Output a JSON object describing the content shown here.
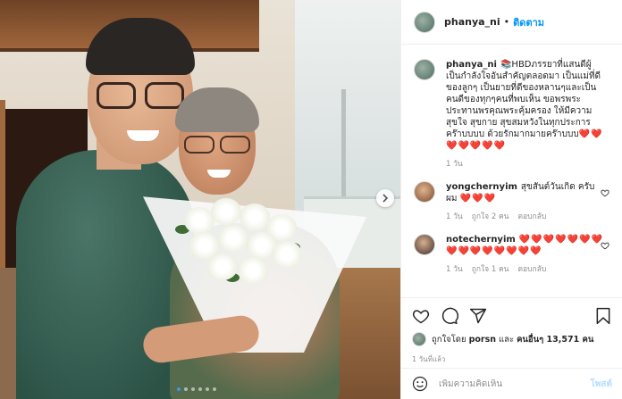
{
  "post": {
    "username": "phanya_ni",
    "follow_label": "ติดตาม",
    "separator": "•",
    "image_alt_icon": "photo",
    "carousel": {
      "total_slides": 6,
      "active_index": 0
    }
  },
  "caption": {
    "username": "phanya_ni",
    "text": "📚HBDภรรยาที่แสนดีผู้เป็นกำลังใจอันสำคัญตลอดมา เป็นแม่ที่ดีของลูกๆ เป็นยายที่ดีของหลานๆและเป็นคนดีของทุกๆคนที่พบเห็น ขอพรพระประทานพรคุณพระคุ้มครอง ให้มีความสุขใจ สุขกาย สุขสมหวังในทุกประการคร๊าบบบบ ด้วยรักมากมายคร๊าบบบ",
    "hearts": "❤️❤️❤️❤️❤️❤️❤️",
    "time": "1 วัน"
  },
  "comments": [
    {
      "username": "yongchernyim",
      "text": "สุขสันต์วันเกิด ครับผม",
      "hearts": "❤️❤️❤️",
      "time": "1 วัน",
      "likes": "ถูกใจ 2 คน",
      "reply": "ตอบกลับ"
    },
    {
      "username": "notechernyim",
      "text": "",
      "hearts": "❤️❤️❤️❤️❤️❤️❤️❤️❤️❤️❤️❤️❤️❤️❤️",
      "time": "1 วัน",
      "likes": "ถูกใจ 1 คน",
      "reply": "ตอบกลับ"
    }
  ],
  "likes": {
    "prefix": "ถูกใจโดย",
    "first_user": "porsn",
    "connector": "และ",
    "others": "คนอื่นๆ 13,571 คน"
  },
  "posted_time": "1 วันที่แล้ว",
  "add_comment": {
    "placeholder": "เพิ่มความคิดเห็น",
    "post_label": "โพสต์"
  },
  "colors": {
    "link_blue": "#0095f6",
    "post_disabled": "#b2dffc",
    "heart_red": "#ed2a3a",
    "muted": "#8e8e8e"
  },
  "icons": [
    "heart-icon",
    "comment-icon",
    "share-icon",
    "bookmark-icon",
    "emoji-icon",
    "chevron-right-icon"
  ]
}
